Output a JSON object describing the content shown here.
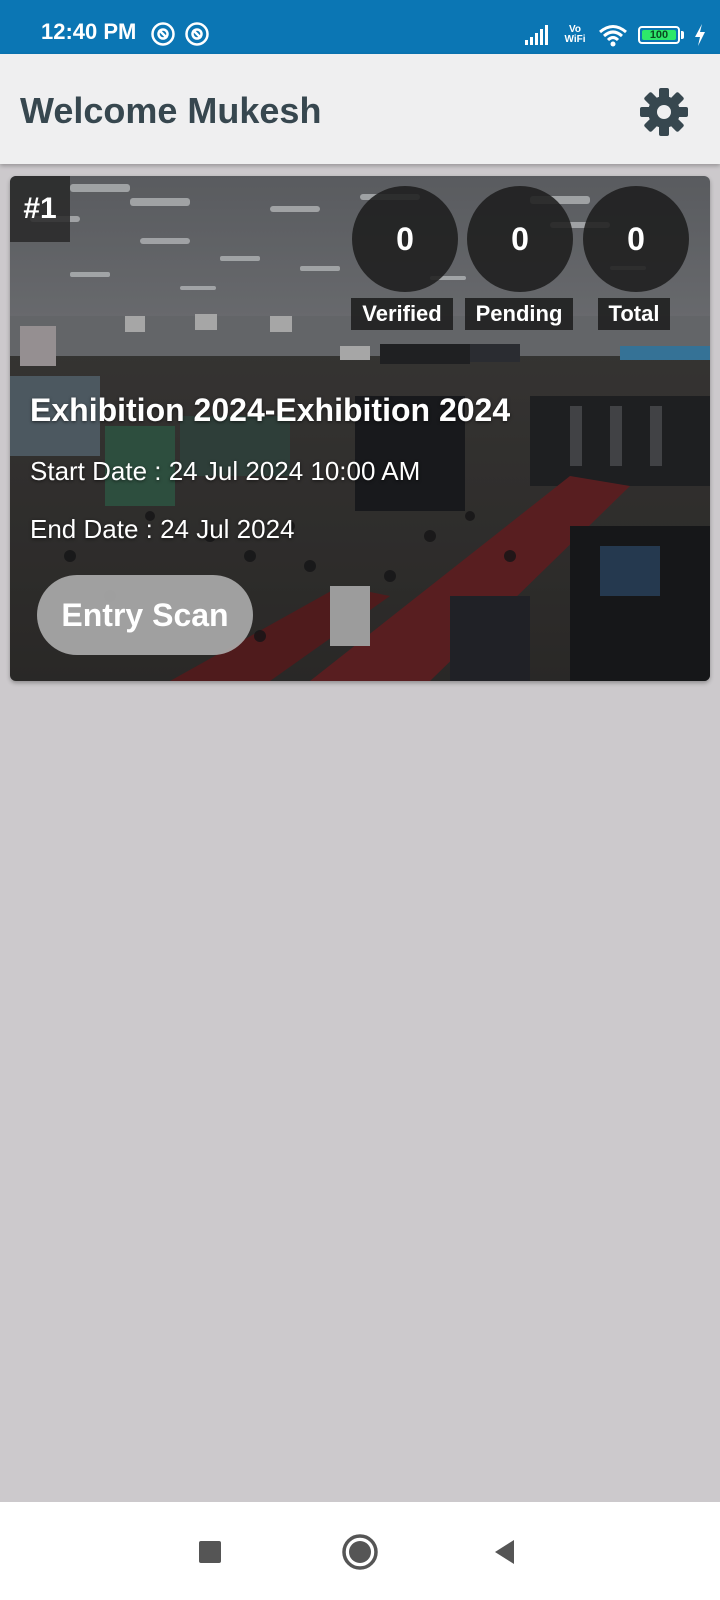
{
  "status_bar": {
    "time": "12:40 PM",
    "volte_label_top": "Vo",
    "volte_label_bottom": "WiFi",
    "battery_level": "100",
    "icons": [
      "app-notification-icon",
      "app-notification-icon",
      "signal-icon",
      "wifi-icon",
      "battery-icon",
      "charging-icon"
    ]
  },
  "app_bar": {
    "title": "Welcome Mukesh",
    "settings_icon": "gear-icon"
  },
  "events": [
    {
      "index_label": "#1",
      "stats": {
        "verified": {
          "count": "0",
          "label": "Verified"
        },
        "pending": {
          "count": "0",
          "label": "Pending"
        },
        "total": {
          "count": "0",
          "label": "Total"
        }
      },
      "title": "Exhibition 2024-Exhibition 2024",
      "start_date": "Start Date : 24 Jul 2024 10:00 AM",
      "end_date": "End Date : 24 Jul 2024",
      "action_label": "Entry Scan"
    }
  ],
  "nav_bar": {
    "icons": [
      "recents-icon",
      "home-icon",
      "back-icon"
    ]
  },
  "colors": {
    "status_bar": "#0b76b4",
    "app_bar": "#efeff0",
    "title_text": "#37474f",
    "page_background": "#ccc9cc"
  }
}
